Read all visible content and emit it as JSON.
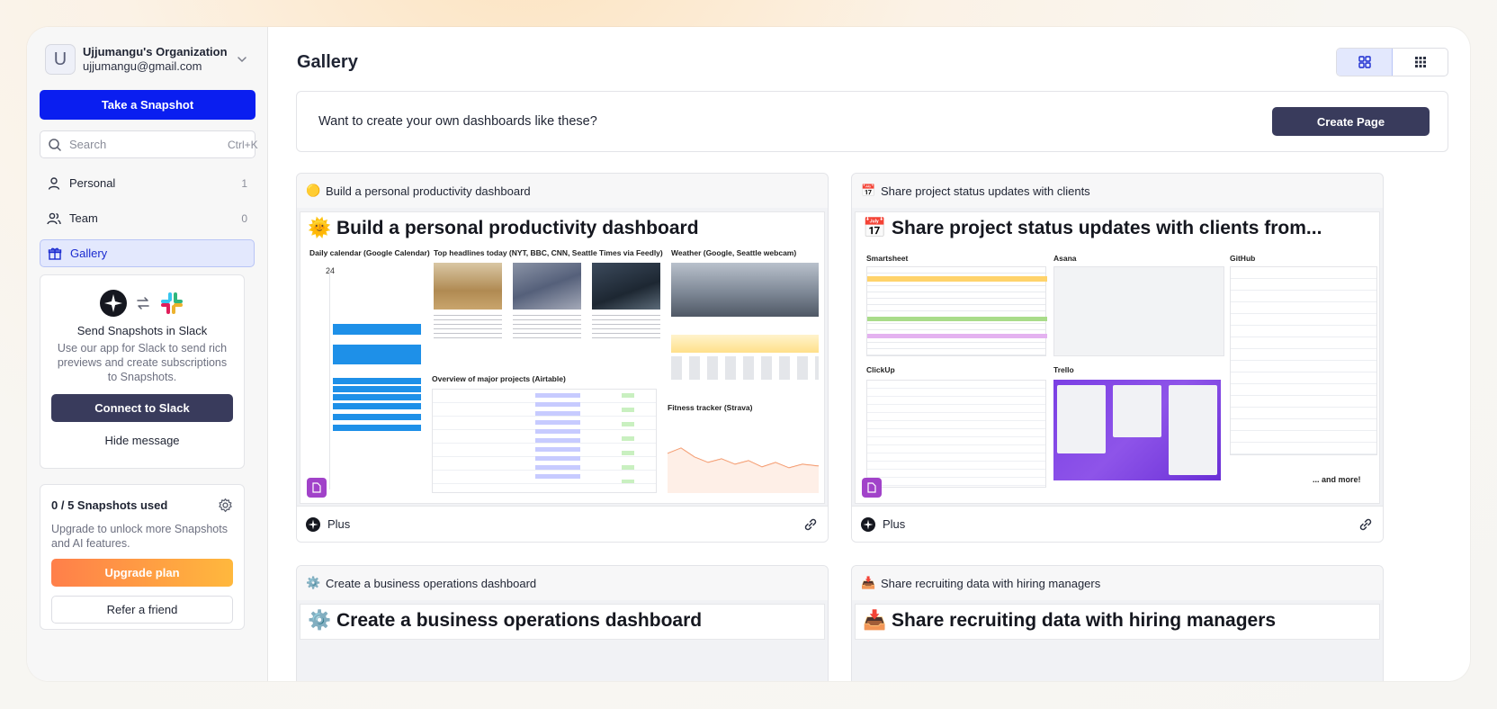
{
  "sidebar": {
    "org": {
      "avatar_letter": "U",
      "name": "Ujjumangu's Organization",
      "email": "ujjumangu@gmail.com"
    },
    "snapshot_button": "Take a Snapshot",
    "search": {
      "placeholder": "Search",
      "shortcut": "Ctrl+K"
    },
    "nav": [
      {
        "label": "Personal",
        "count": "1",
        "icon": "person-icon"
      },
      {
        "label": "Team",
        "count": "0",
        "icon": "team-icon"
      },
      {
        "label": "Gallery",
        "count": "",
        "icon": "gift-icon"
      }
    ],
    "slack_card": {
      "title": "Send Snapshots in Slack",
      "description": "Use our app for Slack to send rich previews and create subscriptions to Snapshots.",
      "connect_button": "Connect to Slack",
      "hide_button": "Hide message"
    },
    "usage_card": {
      "title": "0 / 5 Snapshots used",
      "description": "Upgrade to unlock more Snapshots and AI features.",
      "upgrade_button": "Upgrade plan",
      "refer_button": "Refer a friend"
    }
  },
  "main": {
    "title": "Gallery",
    "banner": {
      "text": "Want to create your own dashboards like these?",
      "button": "Create Page"
    },
    "cards": [
      {
        "header": "Build a personal productivity dashboard",
        "header_emoji": "🟡",
        "preview_title": "🌞 Build a personal productivity dashboard",
        "plan": "Plus",
        "preview_sections": [
          "Daily calendar (Google Calendar)",
          "Top headlines today (NYT, BBC, CNN, Seattle Times via Feedly)",
          "Weather (Google, Seattle webcam)",
          "Overview of major projects (Airtable)",
          "Fitness tracker (Strava)"
        ]
      },
      {
        "header": "Share project status updates with clients",
        "header_emoji": "📅",
        "preview_title": "📅 Share project status updates with clients from...",
        "plan": "Plus",
        "preview_sections": [
          "Smartsheet",
          "Asana",
          "GitHub",
          "ClickUp",
          "Trello"
        ],
        "more_text": "... and more!"
      },
      {
        "header": "Create a business operations dashboard",
        "header_emoji": "⚙️",
        "preview_title": "⚙️ Create a business operations dashboard"
      },
      {
        "header": "Share recruiting data with hiring managers",
        "header_emoji": "📥",
        "preview_title": "📥 Share recruiting data with hiring managers"
      }
    ]
  },
  "colors": {
    "primary": "#0a1ef0",
    "dark_button": "#393b5c",
    "gallery_active_bg": "#e3e8fd",
    "upgrade_gradient_start": "#ff7f4a",
    "upgrade_gradient_end": "#ffb83d",
    "doc_badge": "#a142c9"
  }
}
